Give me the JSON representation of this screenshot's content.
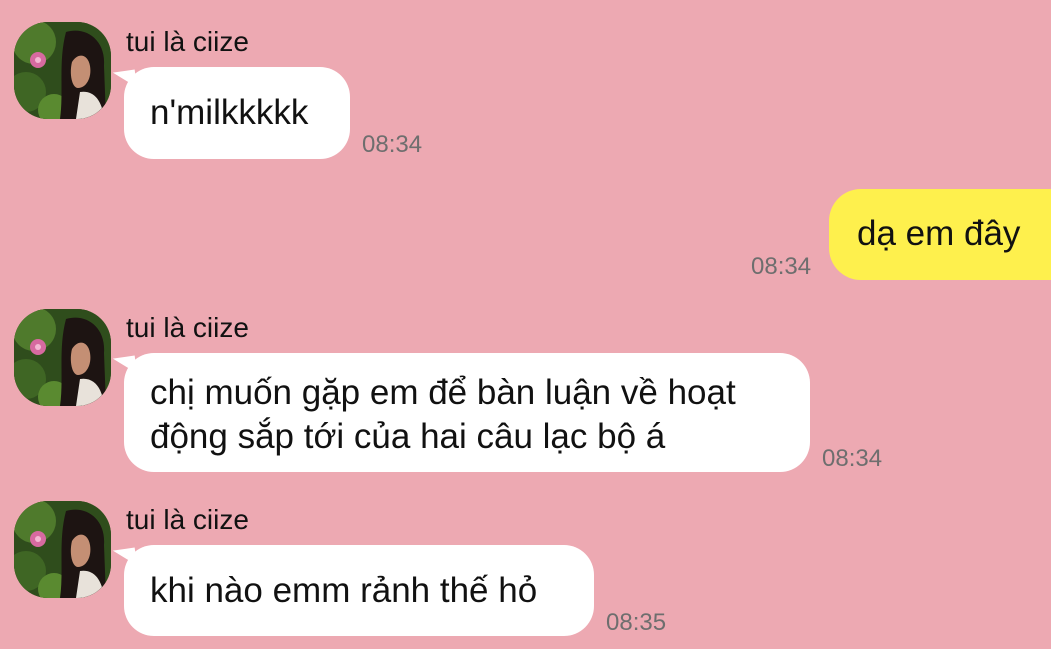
{
  "messages": [
    {
      "sender": "tui là ciize",
      "text": "n'milkkkkk",
      "time": "08:34"
    },
    {
      "text": "dạ em đây",
      "time": "08:34"
    },
    {
      "sender": "tui là ciize",
      "text": "chị muốn gặp em để bàn luận về hoạt động sắp tới của hai câu lạc bộ á",
      "time": "08:34"
    },
    {
      "sender": "tui là ciize",
      "text": "khi nào emm rảnh thế hỏ",
      "time": "08:35"
    }
  ],
  "colors": {
    "background": "#eda9b2",
    "incoming_bubble": "#ffffff",
    "outgoing_bubble": "#fef04d",
    "time_text": "#6e6e6e"
  }
}
